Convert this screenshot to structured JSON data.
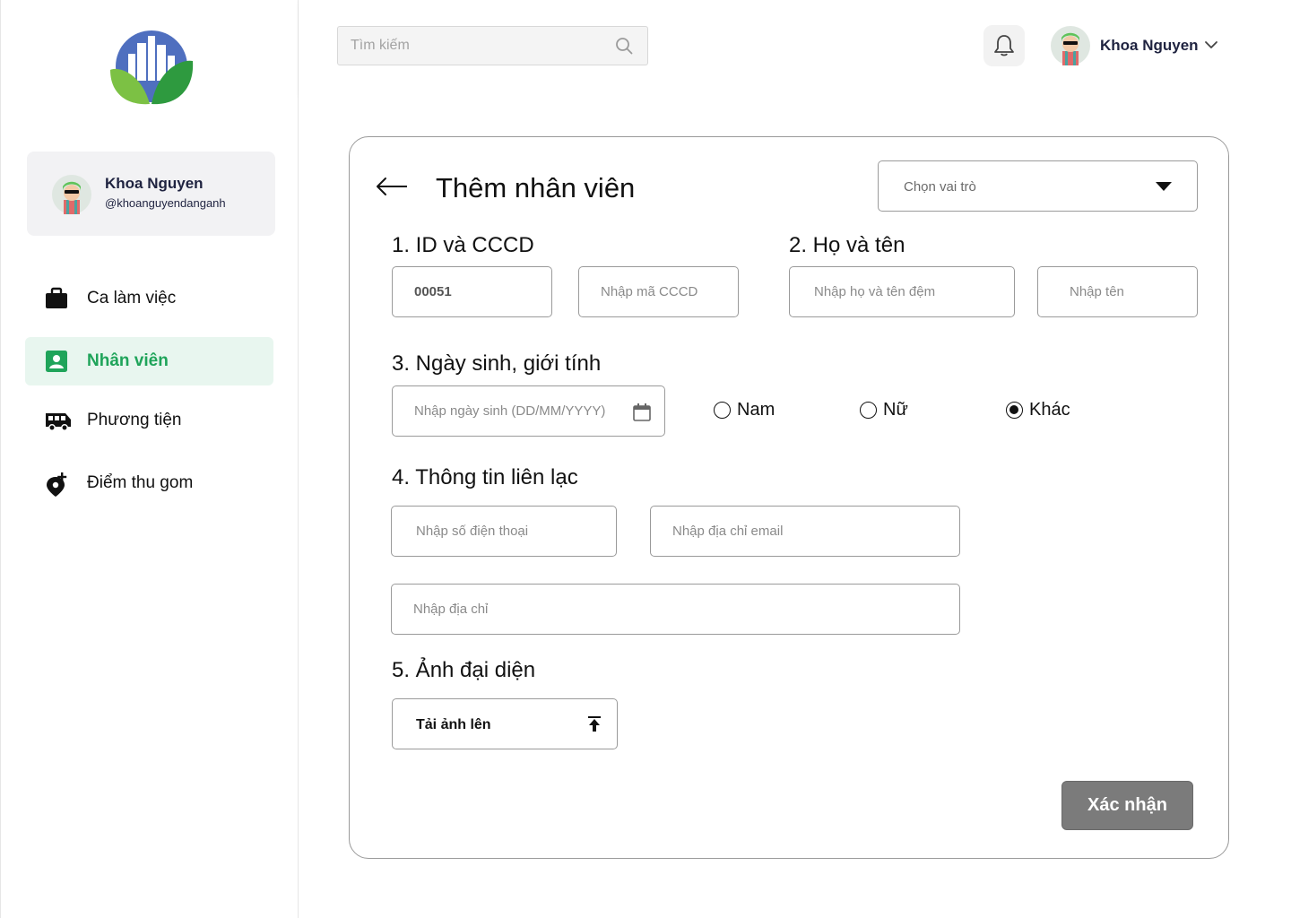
{
  "sidebar": {
    "profile": {
      "name": "Khoa Nguyen",
      "handle": "@khoanguyendanganh"
    },
    "items": [
      {
        "label": "Ca làm việc",
        "icon": "briefcase-icon",
        "active": false
      },
      {
        "label": "Nhân viên",
        "icon": "contact-card-icon",
        "active": true
      },
      {
        "label": "Phương tiện",
        "icon": "bus-icon",
        "active": false
      },
      {
        "label": "Điểm thu gom",
        "icon": "location-add-icon",
        "active": false
      }
    ]
  },
  "header": {
    "search_placeholder": "Tìm kiếm",
    "user_name": "Khoa Nguyen"
  },
  "form": {
    "title": "Thêm nhân viên",
    "role_placeholder": "Chọn vai trò",
    "sections": {
      "id": "1. ID và CCCD",
      "name": "2. Họ và tên",
      "birth": "3. Ngày sinh, giới tính",
      "contact": "4. Thông tin liên lạc",
      "avatar": "5. Ảnh đại diện"
    },
    "fields": {
      "id_value": "00051",
      "cccd_placeholder": "Nhập mã CCCD",
      "middle_name_placeholder": "Nhập họ và tên đệm",
      "first_name_placeholder": "Nhập tên",
      "birthdate_placeholder": "Nhập ngày sinh (DD/MM/YYYY)",
      "phone_placeholder": "Nhập số điện thoại",
      "email_placeholder": "Nhập địa chỉ email",
      "address_placeholder": "Nhập địa chỉ"
    },
    "gender": {
      "options": [
        "Nam",
        "Nữ",
        "Khác"
      ],
      "selected": "Khác"
    },
    "upload_label": "Tải ảnh lên",
    "submit_label": "Xác nhận"
  },
  "colors": {
    "accent_green": "#1fa45a",
    "active_bg": "#e8f6ef",
    "submit_bg": "#7b7b7b"
  }
}
